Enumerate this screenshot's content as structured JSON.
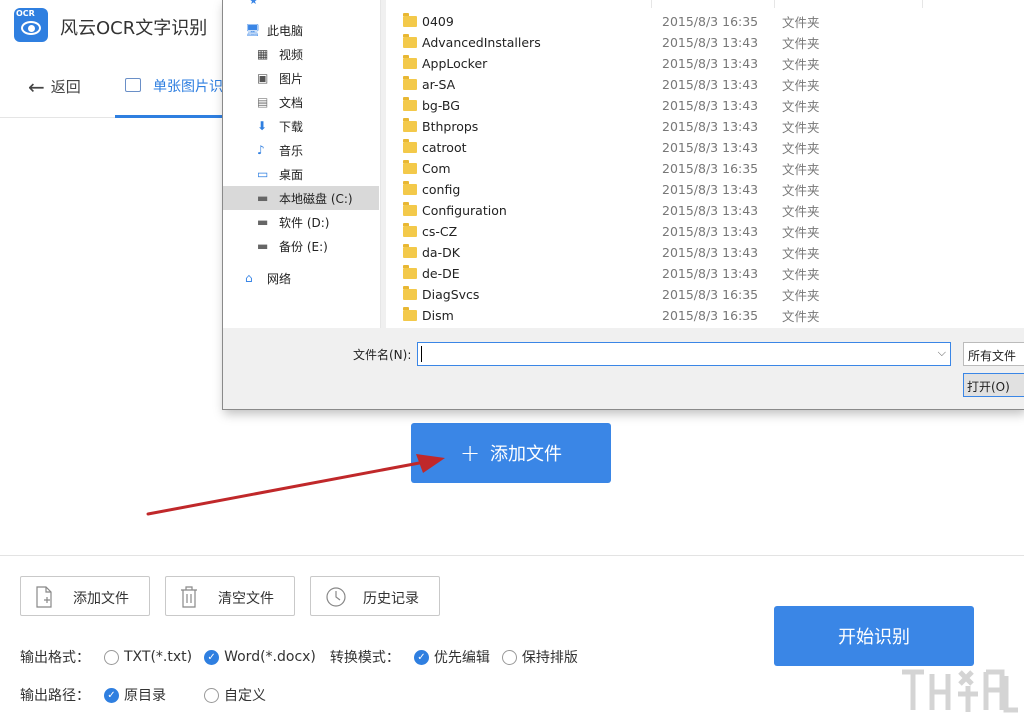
{
  "app": {
    "logo_text": "OCR",
    "title": "风云OCR文字识别"
  },
  "nav": {
    "back_label": "返回",
    "tab_single_label": "单张图片识"
  },
  "main": {
    "add_file_label": "添加文件"
  },
  "toolbar": {
    "add_file": "添加文件",
    "clear_file": "清空文件",
    "history": "历史记录"
  },
  "start_button": "开始识别",
  "options": {
    "output_format_label": "输出格式：",
    "format_txt": "TXT(*.txt)",
    "format_word": "Word(*.docx)",
    "convert_mode_label": "转换模式：",
    "mode_edit": "优先编辑",
    "mode_layout": "保持排版",
    "output_path_label": "输出路径：",
    "path_original": "原目录",
    "path_custom": "自定义",
    "selected_format": "Word(*.docx)",
    "selected_mode": "优先编辑",
    "selected_path": "原目录"
  },
  "dialog": {
    "nav_items": [
      {
        "label": "此电脑",
        "icon": "computer-icon"
      },
      {
        "label": "视频",
        "icon": "video-icon"
      },
      {
        "label": "图片",
        "icon": "picture-icon"
      },
      {
        "label": "文档",
        "icon": "document-icon"
      },
      {
        "label": "下载",
        "icon": "download-icon"
      },
      {
        "label": "音乐",
        "icon": "music-icon"
      },
      {
        "label": "桌面",
        "icon": "desktop-icon"
      },
      {
        "label": "本地磁盘 (C:)",
        "icon": "drive-icon"
      },
      {
        "label": "软件 (D:)",
        "icon": "drive-icon"
      },
      {
        "label": "备份 (E:)",
        "icon": "drive-icon"
      },
      {
        "label": "网络",
        "icon": "network-icon"
      }
    ],
    "files": [
      {
        "name": "0409",
        "date": "2015/8/3 16:35",
        "type": "文件夹"
      },
      {
        "name": "AdvancedInstallers",
        "date": "2015/8/3 13:43",
        "type": "文件夹"
      },
      {
        "name": "AppLocker",
        "date": "2015/8/3 13:43",
        "type": "文件夹"
      },
      {
        "name": "ar-SA",
        "date": "2015/8/3 13:43",
        "type": "文件夹"
      },
      {
        "name": "bg-BG",
        "date": "2015/8/3 13:43",
        "type": "文件夹"
      },
      {
        "name": "Bthprops",
        "date": "2015/8/3 13:43",
        "type": "文件夹"
      },
      {
        "name": "catroot",
        "date": "2015/8/3 13:43",
        "type": "文件夹"
      },
      {
        "name": "Com",
        "date": "2015/8/3 16:35",
        "type": "文件夹"
      },
      {
        "name": "config",
        "date": "2015/8/3 13:43",
        "type": "文件夹"
      },
      {
        "name": "Configuration",
        "date": "2015/8/3 13:43",
        "type": "文件夹"
      },
      {
        "name": "cs-CZ",
        "date": "2015/8/3 13:43",
        "type": "文件夹"
      },
      {
        "name": "da-DK",
        "date": "2015/8/3 13:43",
        "type": "文件夹"
      },
      {
        "name": "de-DE",
        "date": "2015/8/3 13:43",
        "type": "文件夹"
      },
      {
        "name": "DiagSvcs",
        "date": "2015/8/3 16:35",
        "type": "文件夹"
      },
      {
        "name": "Dism",
        "date": "2015/8/3 16:35",
        "type": "文件夹"
      }
    ],
    "filename_label": "文件名(N):",
    "filename_value": "",
    "filetype_value": "所有文件",
    "open_label": "打开(O)"
  },
  "colors": {
    "accent": "#3a86e6",
    "arrow": "#c0282a"
  }
}
